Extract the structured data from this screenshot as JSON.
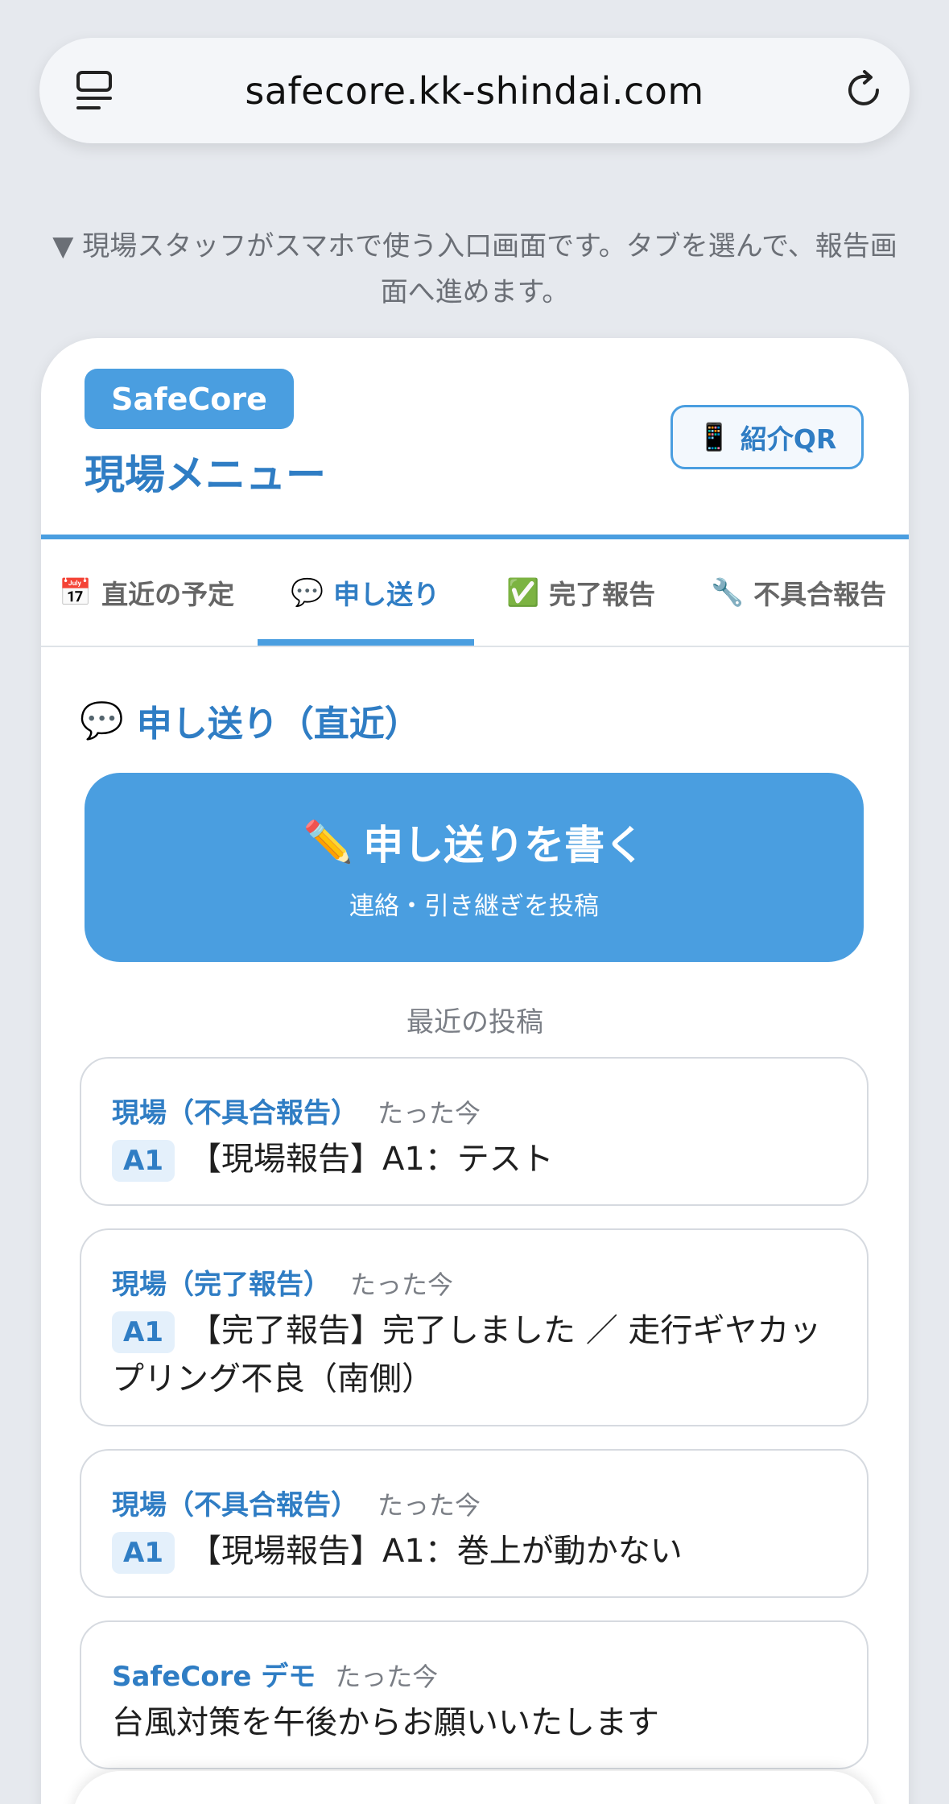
{
  "browser": {
    "url": "safecore.kk-shindai.com"
  },
  "caption": "▼ 現場スタッフがスマホで使う入口画面です。タブを選んで、報告画面へ進めます。",
  "header": {
    "brand": "SafeCore",
    "title": "現場メニュー",
    "qr_button": {
      "icon": "📱",
      "label": "紹介QR"
    }
  },
  "tabs": [
    {
      "icon": "📅",
      "label": "直近の予定",
      "active": false
    },
    {
      "icon": "💬",
      "label": "申し送り",
      "active": true
    },
    {
      "icon": "✅",
      "label": "完了報告",
      "active": false
    },
    {
      "icon": "🔧",
      "label": "不具合報告",
      "active": false
    }
  ],
  "section": {
    "icon": "💬",
    "title": "申し送り（直近）",
    "write_button": {
      "icon": "✏️",
      "label": "申し送りを書く",
      "sub": "連絡・引き継ぎを投稿"
    },
    "recent_label": "最近の投稿"
  },
  "posts": [
    {
      "author": "現場（不具合報告）",
      "time": "たった今",
      "tag": "A1",
      "text": "【現場報告】A1：テスト"
    },
    {
      "author": "現場（完了報告）",
      "time": "たった今",
      "tag": "A1",
      "text": "【完了報告】完了しました ／ 走行ギヤカップリング不良（南側）"
    },
    {
      "author": "現場（不具合報告）",
      "time": "たった今",
      "tag": "A1",
      "text": "【現場報告】A1：巻上が動かない"
    },
    {
      "author": "SafeCore デモ",
      "time": "たった今",
      "tag": "",
      "text": "台風対策を午後からお願いいたします"
    }
  ]
}
